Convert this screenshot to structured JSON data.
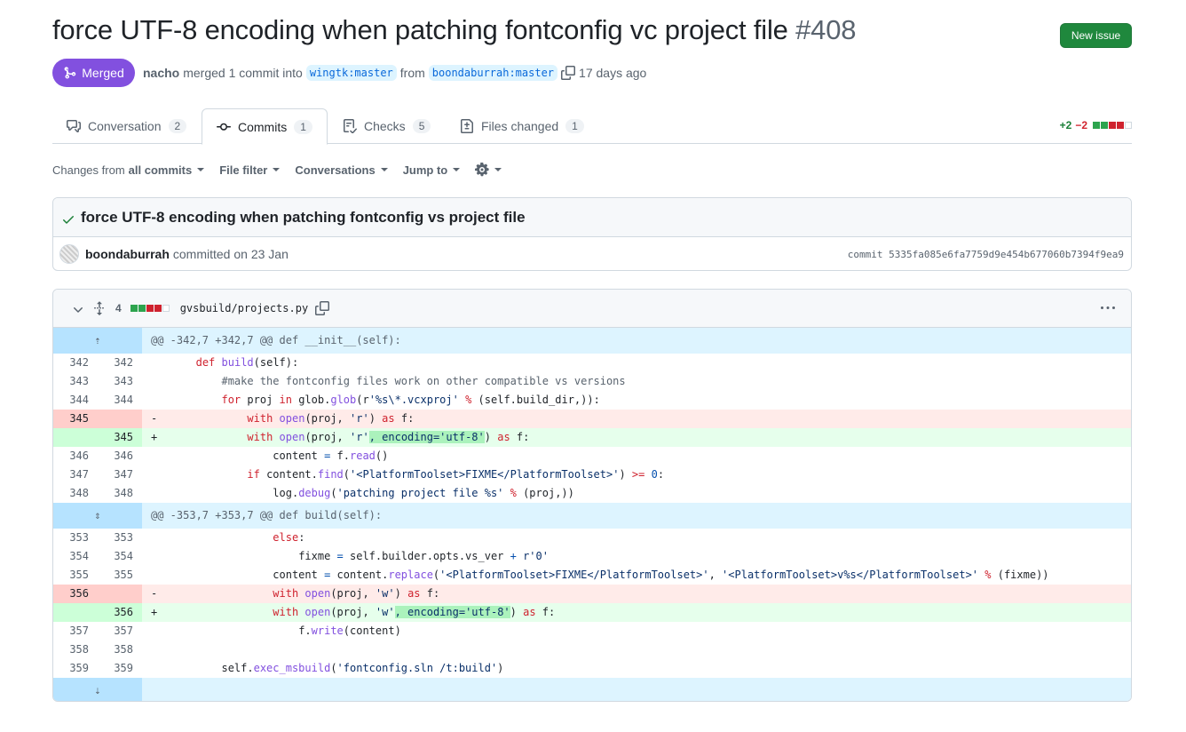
{
  "header": {
    "title": "force UTF-8 encoding when patching fontconfig vc project file",
    "number": "#408",
    "new_issue_label": "New issue"
  },
  "meta": {
    "state": "Merged",
    "author": "nacho",
    "action": "merged 1 commit into",
    "base_branch": "wingtk:master",
    "from": "from",
    "head_branch": "boondaburrah:master",
    "time": "17 days ago"
  },
  "tabs": [
    {
      "label": "Conversation",
      "count": "2"
    },
    {
      "label": "Commits",
      "count": "1"
    },
    {
      "label": "Checks",
      "count": "5"
    },
    {
      "label": "Files changed",
      "count": "1"
    }
  ],
  "diffstat": {
    "additions": "+2",
    "deletions": "−2"
  },
  "toolbar": {
    "changes_prefix": "Changes from",
    "changes_value": "all commits",
    "file_filter": "File filter",
    "conversations": "Conversations",
    "jump_to": "Jump to"
  },
  "commit": {
    "title": "force UTF-8 encoding when patching fontconfig vs project file",
    "author": "boondaburrah",
    "when": "committed on 23 Jan",
    "sha": "commit 5335fa085e6fa7759d9e454b677060b7394f9ea9"
  },
  "file": {
    "changes": "4",
    "path": "gvsbuild/projects.py"
  },
  "hunks": [
    "@@ -342,7 +342,7 @@ def __init__(self):",
    "@@ -353,7 +353,7 @@ def build(self):"
  ],
  "lines": [
    {
      "old": "342",
      "new": "342",
      "mark": " "
    },
    {
      "old": "343",
      "new": "343",
      "mark": " "
    },
    {
      "old": "344",
      "new": "344",
      "mark": " "
    },
    {
      "old": "345",
      "new": "",
      "mark": "-"
    },
    {
      "old": "",
      "new": "345",
      "mark": "+"
    },
    {
      "old": "346",
      "new": "346",
      "mark": " "
    },
    {
      "old": "347",
      "new": "347",
      "mark": " "
    },
    {
      "old": "348",
      "new": "348",
      "mark": " "
    },
    {
      "old": "353",
      "new": "353",
      "mark": " "
    },
    {
      "old": "354",
      "new": "354",
      "mark": " "
    },
    {
      "old": "355",
      "new": "355",
      "mark": " "
    },
    {
      "old": "356",
      "new": "",
      "mark": "-"
    },
    {
      "old": "",
      "new": "356",
      "mark": "+"
    },
    {
      "old": "357",
      "new": "357",
      "mark": " "
    },
    {
      "old": "358",
      "new": "358",
      "mark": " "
    },
    {
      "old": "359",
      "new": "359",
      "mark": " "
    }
  ],
  "code": {
    "l342_kw": "def",
    "l342_fn": "build",
    "l342_rest": "(self):",
    "l343_comment": "#make the fontconfig files work on other compatible vs versions",
    "l344_for": "for",
    "l344_proj": " proj ",
    "l344_in": "in",
    "l344_glob": " glob.",
    "l344_globfn": "glob",
    "l344_open": "(r",
    "l344_str": "'%s\\*.vcxproj'",
    "l344_pct": " % ",
    "l344_rest": "(self.build_dir,)):",
    "with": "with",
    "open": "open",
    "as": "as",
    "l345_args": "(proj, ",
    "str_r": "'r'",
    "str_w": "'w'",
    "enc_hl": ", encoding='utf-8'",
    "close_paren": ")",
    "f_colon": " f:",
    "l346_a": "content ",
    "eq": "=",
    "l346_b": " f.",
    "read": "read",
    "l346_c": "()",
    "if": "if",
    "l347_a": " content.",
    "find": "find",
    "l347_str": "'<PlatformToolset>FIXME</PlatformToolset>'",
    "l347_b": ") ",
    "ge": ">=",
    "zero": "0",
    "colon": ":",
    "l348_a": "log.",
    "debug": "debug",
    "l348_str": "'patching project file %s'",
    "pct": "%",
    "l348_b": " (proj,))",
    "else": "else",
    "l354_a": "fixme ",
    "l354_b": " self.builder.opts.vs_ver ",
    "plus": "+",
    "l354_str": " r'0'",
    "l355_a": "content ",
    "l355_b": " content.",
    "replace": "replace",
    "l355_str1": "'<PlatformToolset>FIXME</PlatformToolset>'",
    "comma": ", ",
    "l355_str2": "'<PlatformToolset>v%s</PlatformToolset>'",
    "l355_c": " (fixme))",
    "l357_a": "f.",
    "write": "write",
    "l357_b": "(content)",
    "l359_a": "self.",
    "exec": "exec_msbuild",
    "l359_str": "'fontconfig.sln /t:build'",
    "open_paren": "("
  },
  "colors": {
    "merged": "#8250df",
    "primary": "#1f883d",
    "add": "#1a7f37",
    "del": "#d1242f"
  }
}
